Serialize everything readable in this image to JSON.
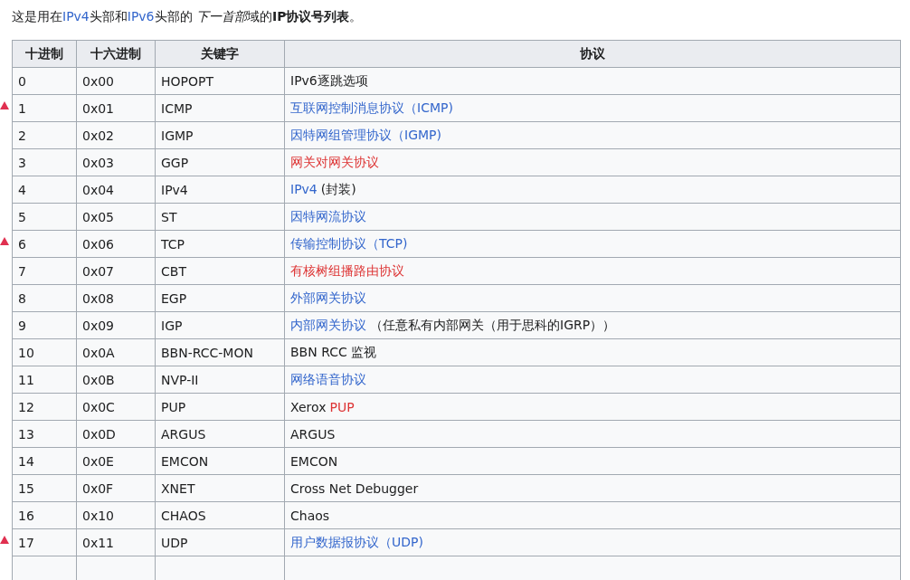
{
  "intro": [
    {
      "text": "这是用在",
      "kind": "plain"
    },
    {
      "text": "IPv4",
      "kind": "link"
    },
    {
      "text": "头部和",
      "kind": "plain"
    },
    {
      "text": "IPv6",
      "kind": "link"
    },
    {
      "text": "头部的 ",
      "kind": "plain"
    },
    {
      "text": "下一首部",
      "kind": "italic"
    },
    {
      "text": "域的",
      "kind": "plain"
    },
    {
      "text": "IP协议号列表",
      "kind": "bold"
    },
    {
      "text": "。",
      "kind": "plain"
    }
  ],
  "table": {
    "columns": [
      "十进制",
      "十六进制",
      "关键字",
      "协议"
    ],
    "rows": [
      {
        "marked": false,
        "decimal": "0",
        "hex": "0x00",
        "keyword": "HOPOPT",
        "protocol": [
          {
            "text": "IPv6逐跳选项",
            "kind": "plain"
          }
        ]
      },
      {
        "marked": true,
        "decimal": "1",
        "hex": "0x01",
        "keyword": "ICMP",
        "protocol": [
          {
            "text": "互联网控制消息协议（ICMP)",
            "kind": "link"
          }
        ]
      },
      {
        "marked": false,
        "decimal": "2",
        "hex": "0x02",
        "keyword": "IGMP",
        "protocol": [
          {
            "text": "因特网组管理协议（IGMP)",
            "kind": "link"
          }
        ]
      },
      {
        "marked": false,
        "decimal": "3",
        "hex": "0x03",
        "keyword": "GGP",
        "protocol": [
          {
            "text": "网关对网关协议",
            "kind": "redlink"
          }
        ]
      },
      {
        "marked": false,
        "decimal": "4",
        "hex": "0x04",
        "keyword": "IPv4",
        "protocol": [
          {
            "text": "IPv4",
            "kind": "link"
          },
          {
            "text": "(封装)",
            "kind": "plain"
          }
        ]
      },
      {
        "marked": false,
        "decimal": "5",
        "hex": "0x05",
        "keyword": "ST",
        "protocol": [
          {
            "text": "因特网流协议",
            "kind": "link"
          }
        ]
      },
      {
        "marked": true,
        "decimal": "6",
        "hex": "0x06",
        "keyword": "TCP",
        "protocol": [
          {
            "text": "传输控制协议（TCP)",
            "kind": "link"
          }
        ]
      },
      {
        "marked": false,
        "decimal": "7",
        "hex": "0x07",
        "keyword": "CBT",
        "protocol": [
          {
            "text": "有核树组播路由协议",
            "kind": "redlink"
          }
        ]
      },
      {
        "marked": false,
        "decimal": "8",
        "hex": "0x08",
        "keyword": "EGP",
        "protocol": [
          {
            "text": "外部网关协议",
            "kind": "link"
          }
        ]
      },
      {
        "marked": false,
        "decimal": "9",
        "hex": "0x09",
        "keyword": "IGP",
        "protocol": [
          {
            "text": "内部网关协议",
            "kind": "link"
          },
          {
            "text": "（任意私有内部网关（用于思科的IGRP））",
            "kind": "plain"
          }
        ]
      },
      {
        "marked": false,
        "decimal": "10",
        "hex": "0x0A",
        "keyword": "BBN-RCC-MON",
        "protocol": [
          {
            "text": "BBN RCC 监视",
            "kind": "plain"
          }
        ]
      },
      {
        "marked": false,
        "decimal": "11",
        "hex": "0x0B",
        "keyword": "NVP-II",
        "protocol": [
          {
            "text": "网络语音协议",
            "kind": "link"
          }
        ]
      },
      {
        "marked": false,
        "decimal": "12",
        "hex": "0x0C",
        "keyword": "PUP",
        "protocol": [
          {
            "text": "Xerox",
            "kind": "plain"
          },
          {
            "text": "PUP",
            "kind": "redlink"
          }
        ]
      },
      {
        "marked": false,
        "decimal": "13",
        "hex": "0x0D",
        "keyword": "ARGUS",
        "protocol": [
          {
            "text": "ARGUS",
            "kind": "plain"
          }
        ]
      },
      {
        "marked": false,
        "decimal": "14",
        "hex": "0x0E",
        "keyword": "EMCON",
        "protocol": [
          {
            "text": "EMCON",
            "kind": "plain"
          }
        ]
      },
      {
        "marked": false,
        "decimal": "15",
        "hex": "0x0F",
        "keyword": "XNET",
        "protocol": [
          {
            "text": "Cross Net Debugger",
            "kind": "plain"
          }
        ]
      },
      {
        "marked": false,
        "decimal": "16",
        "hex": "0x10",
        "keyword": "CHAOS",
        "protocol": [
          {
            "text": "Chaos",
            "kind": "plain"
          }
        ]
      },
      {
        "marked": true,
        "decimal": "17",
        "hex": "0x11",
        "keyword": "UDP",
        "protocol": [
          {
            "text": "用户数据报协议（UDP)",
            "kind": "link"
          }
        ]
      }
    ]
  }
}
